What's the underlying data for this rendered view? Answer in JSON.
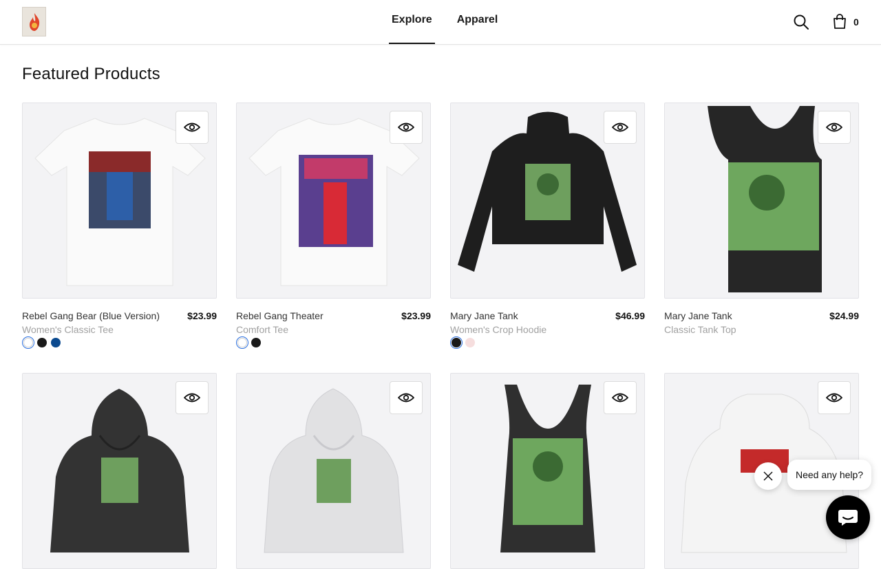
{
  "header": {
    "logo_icon": "flame-logo",
    "nav": [
      {
        "label": "Explore",
        "active": true
      },
      {
        "label": "Apparel",
        "active": false
      }
    ],
    "cart_count": "0",
    "icons": {
      "search": "search-icon",
      "cart": "shopping-bag-icon"
    }
  },
  "main": {
    "heading": "Featured Products",
    "products": [
      {
        "name": "Rebel Gang Bear (Blue Version)",
        "type": "Women's Classic Tee",
        "price": "$23.99",
        "swatches": [
          "#ffffff",
          "#1a1a1a",
          "#0b4a8f"
        ],
        "selected_swatch": 0
      },
      {
        "name": "Rebel Gang Theater",
        "type": "Comfort Tee",
        "price": "$23.99",
        "swatches": [
          "#ffffff",
          "#1a1a1a"
        ],
        "selected_swatch": 0
      },
      {
        "name": "Mary Jane Tank",
        "type": "Women's Crop Hoodie",
        "price": "$46.99",
        "swatches": [
          "#1a1a1a",
          "#f6dede"
        ],
        "selected_swatch": 0
      },
      {
        "name": "Mary Jane Tank",
        "type": "Classic Tank Top",
        "price": "$24.99",
        "swatches": [],
        "selected_swatch": null
      },
      {
        "name": "",
        "type": "",
        "price": "",
        "swatches": [],
        "selected_swatch": null
      },
      {
        "name": "",
        "type": "",
        "price": "",
        "swatches": [],
        "selected_swatch": null
      },
      {
        "name": "",
        "type": "",
        "price": "",
        "swatches": [],
        "selected_swatch": null
      },
      {
        "name": "",
        "type": "",
        "price": "",
        "swatches": [],
        "selected_swatch": null
      }
    ]
  },
  "help_widget": {
    "bubble_text": "Need any help?",
    "close_icon": "close-icon",
    "chat_icon": "chat-icon"
  },
  "colors": {
    "accent": "#2a6fe0",
    "text": "#111111",
    "muted": "#a0a0a0"
  }
}
